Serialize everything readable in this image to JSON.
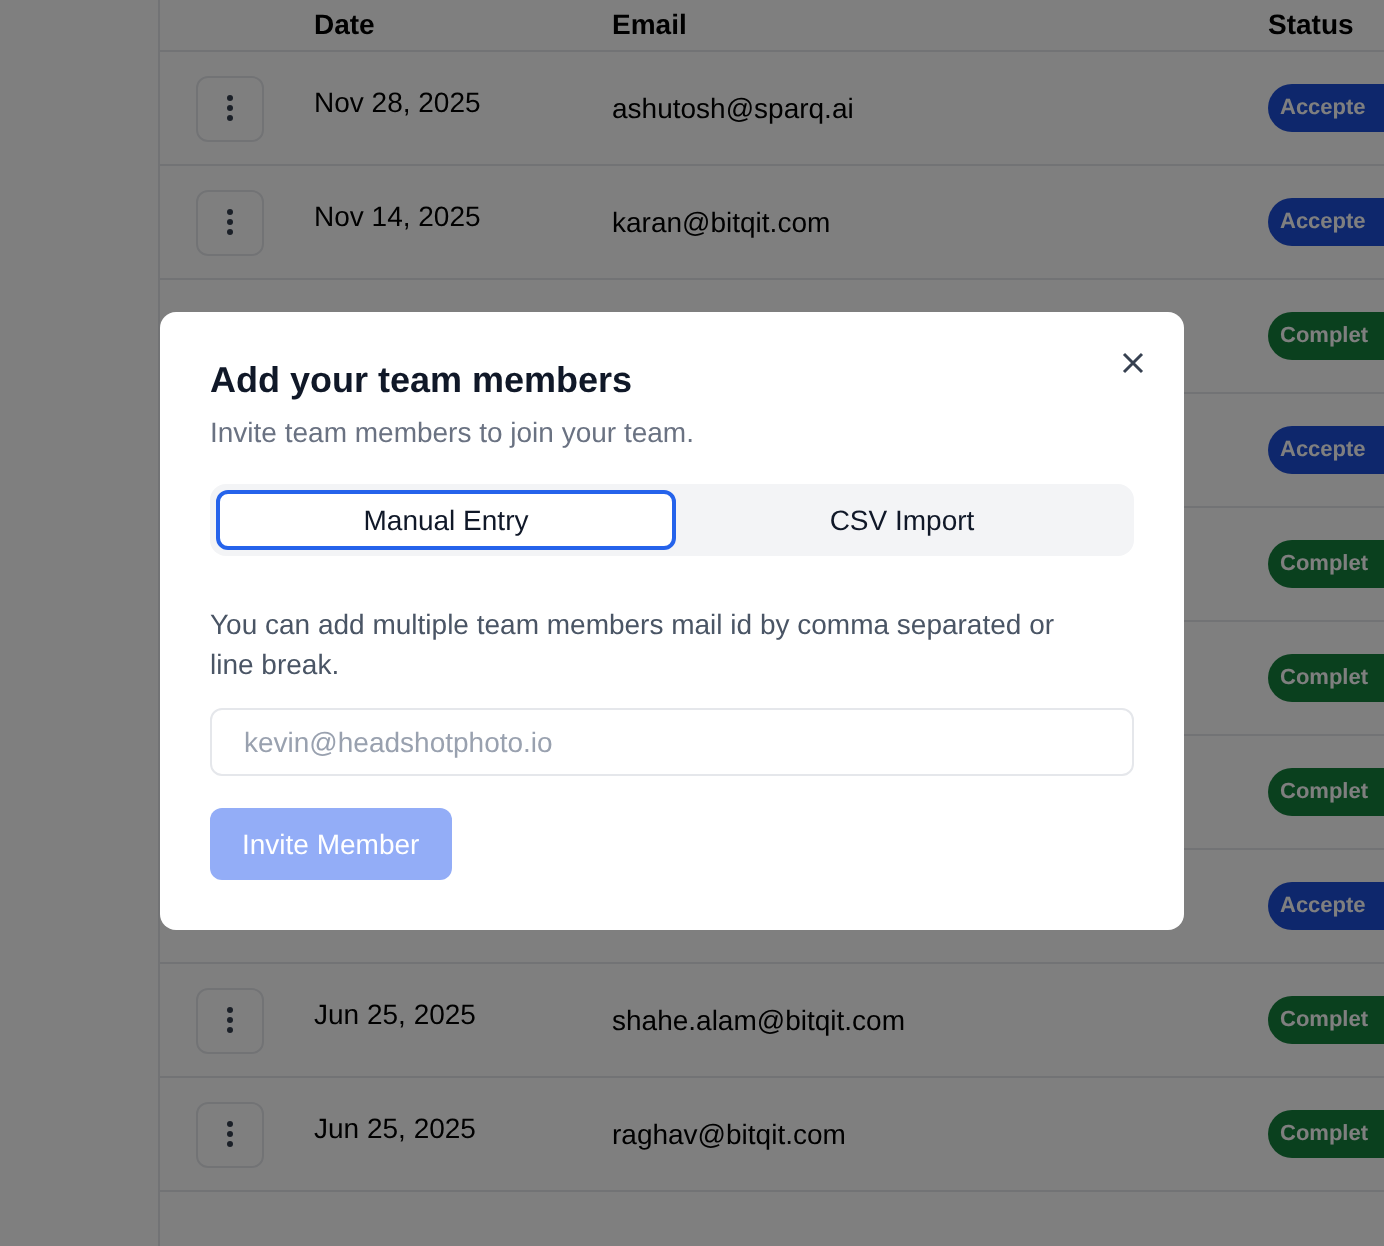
{
  "table": {
    "columns": [
      "Date",
      "Email",
      "Status"
    ],
    "rows": [
      {
        "date": "Nov 28, 2025",
        "email": "ashutosh@sparq.ai",
        "status": "Accepte",
        "kind": "accepted"
      },
      {
        "date": "Nov 14, 2025",
        "email": "karan@bitqit.com",
        "status": "Accepte",
        "kind": "accepted"
      },
      {
        "status": "Complet",
        "kind": "completed"
      },
      {
        "status": "Accepte",
        "kind": "accepted"
      },
      {
        "status": "Complet",
        "kind": "completed"
      },
      {
        "status": "Complet",
        "kind": "completed"
      },
      {
        "status": "Complet",
        "kind": "completed"
      },
      {
        "status": "Accepte",
        "kind": "accepted"
      },
      {
        "date": "Jun 25, 2025",
        "email": "shahe.alam@bitqit.com",
        "status": "Complet",
        "kind": "completed"
      },
      {
        "date": "Jun 25, 2025",
        "email": "raghav@bitqit.com",
        "status": "Complet",
        "kind": "completed"
      }
    ]
  },
  "dialog": {
    "title": "Add your team members",
    "subtitle": "Invite team members to join your team.",
    "tabs": [
      {
        "label": "Manual Entry",
        "selected": true
      },
      {
        "label": "CSV Import",
        "selected": false
      }
    ],
    "help": "You can add multiple team members mail id by comma separated or line break.",
    "input": {
      "placeholder": "kevin@headshotphoto.io"
    },
    "button": {
      "label": "Invite Member",
      "disabled": true
    }
  }
}
